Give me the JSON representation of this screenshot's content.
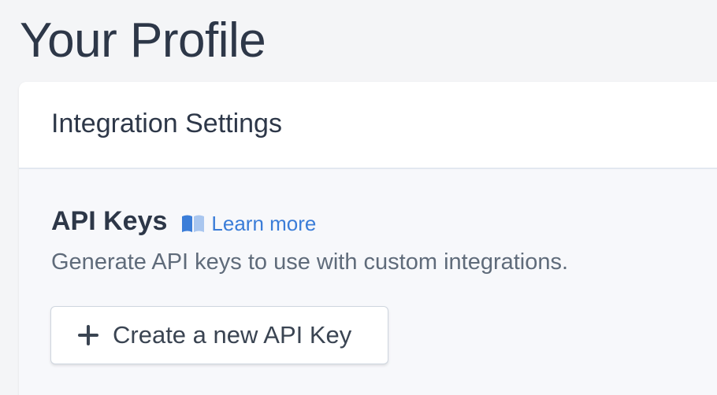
{
  "page": {
    "title": "Your Profile"
  },
  "card": {
    "header_title": "Integration Settings"
  },
  "api_keys": {
    "title": "API Keys",
    "learn_more_label": "Learn more",
    "learn_more_icon": "book-icon",
    "description": "Generate API keys to use with custom integrations.",
    "create_button_label": "Create a new API Key",
    "create_button_icon": "plus-icon"
  },
  "colors": {
    "page_background": "#f4f5f7",
    "card_background": "#ffffff",
    "body_background": "#f7f8fb",
    "heading_text": "#2d3748",
    "muted_text": "#5f6b7a",
    "link": "#3b7dd8"
  }
}
